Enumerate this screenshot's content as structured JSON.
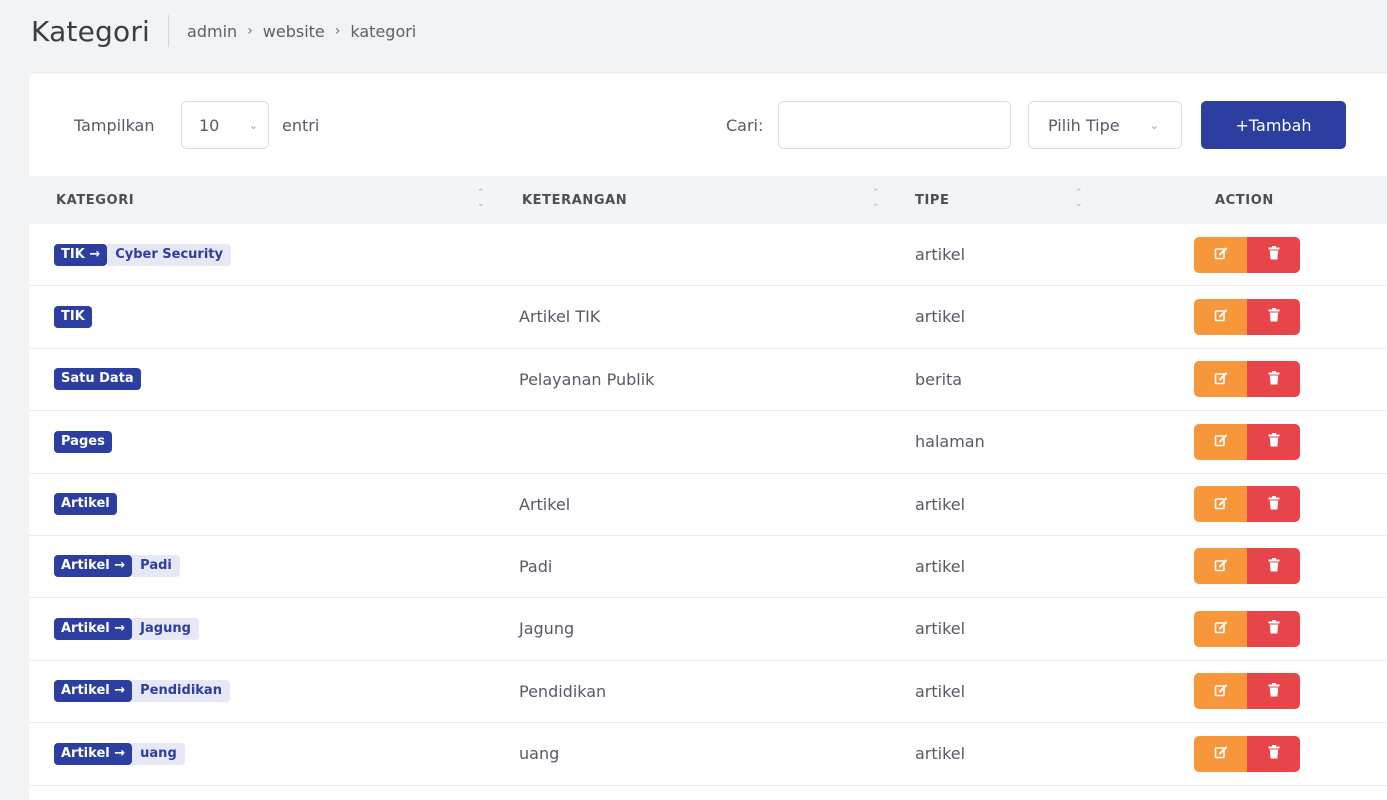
{
  "header": {
    "title": "Kategori",
    "breadcrumb": [
      "admin",
      "website",
      "kategori"
    ],
    "breadcrumb_separator": "›"
  },
  "toolbar": {
    "show_label": "Tampilkan",
    "page_size": "10",
    "entries_label": "entri",
    "search_label": "Cari:",
    "search_value": "",
    "type_select": "Pilih Tipe",
    "add_button": "+Tambah"
  },
  "table": {
    "columns": [
      "KATEGORI",
      "KETERANGAN",
      "TIPE",
      "ACTION"
    ],
    "rows": [
      {
        "parent": "TIK",
        "child": "Cyber Security",
        "keterangan": "",
        "tipe": "artikel"
      },
      {
        "parent": "TIK",
        "child": "",
        "keterangan": "Artikel TIK",
        "tipe": "artikel"
      },
      {
        "parent": "Satu Data",
        "child": "",
        "keterangan": "Pelayanan Publik",
        "tipe": "berita"
      },
      {
        "parent": "Pages",
        "child": "",
        "keterangan": "",
        "tipe": "halaman"
      },
      {
        "parent": "Artikel",
        "child": "",
        "keterangan": "Artikel",
        "tipe": "artikel"
      },
      {
        "parent": "Artikel",
        "child": "Padi",
        "keterangan": "Padi",
        "tipe": "artikel"
      },
      {
        "parent": "Artikel",
        "child": "Jagung",
        "keterangan": "Jagung",
        "tipe": "artikel"
      },
      {
        "parent": "Artikel",
        "child": "Pendidikan",
        "keterangan": "Pendidikan",
        "tipe": "artikel"
      },
      {
        "parent": "Artikel",
        "child": "uang",
        "keterangan": "uang",
        "tipe": "artikel"
      }
    ]
  },
  "colors": {
    "primary": "#2c3ea0",
    "edit": "#f7963a",
    "delete": "#e8454b",
    "child_badge_bg": "#e6e8f6"
  },
  "icons": {
    "edit": "edit-icon",
    "delete": "trash-icon",
    "sort": "sort-icon",
    "select": "chevron-down-icon"
  }
}
